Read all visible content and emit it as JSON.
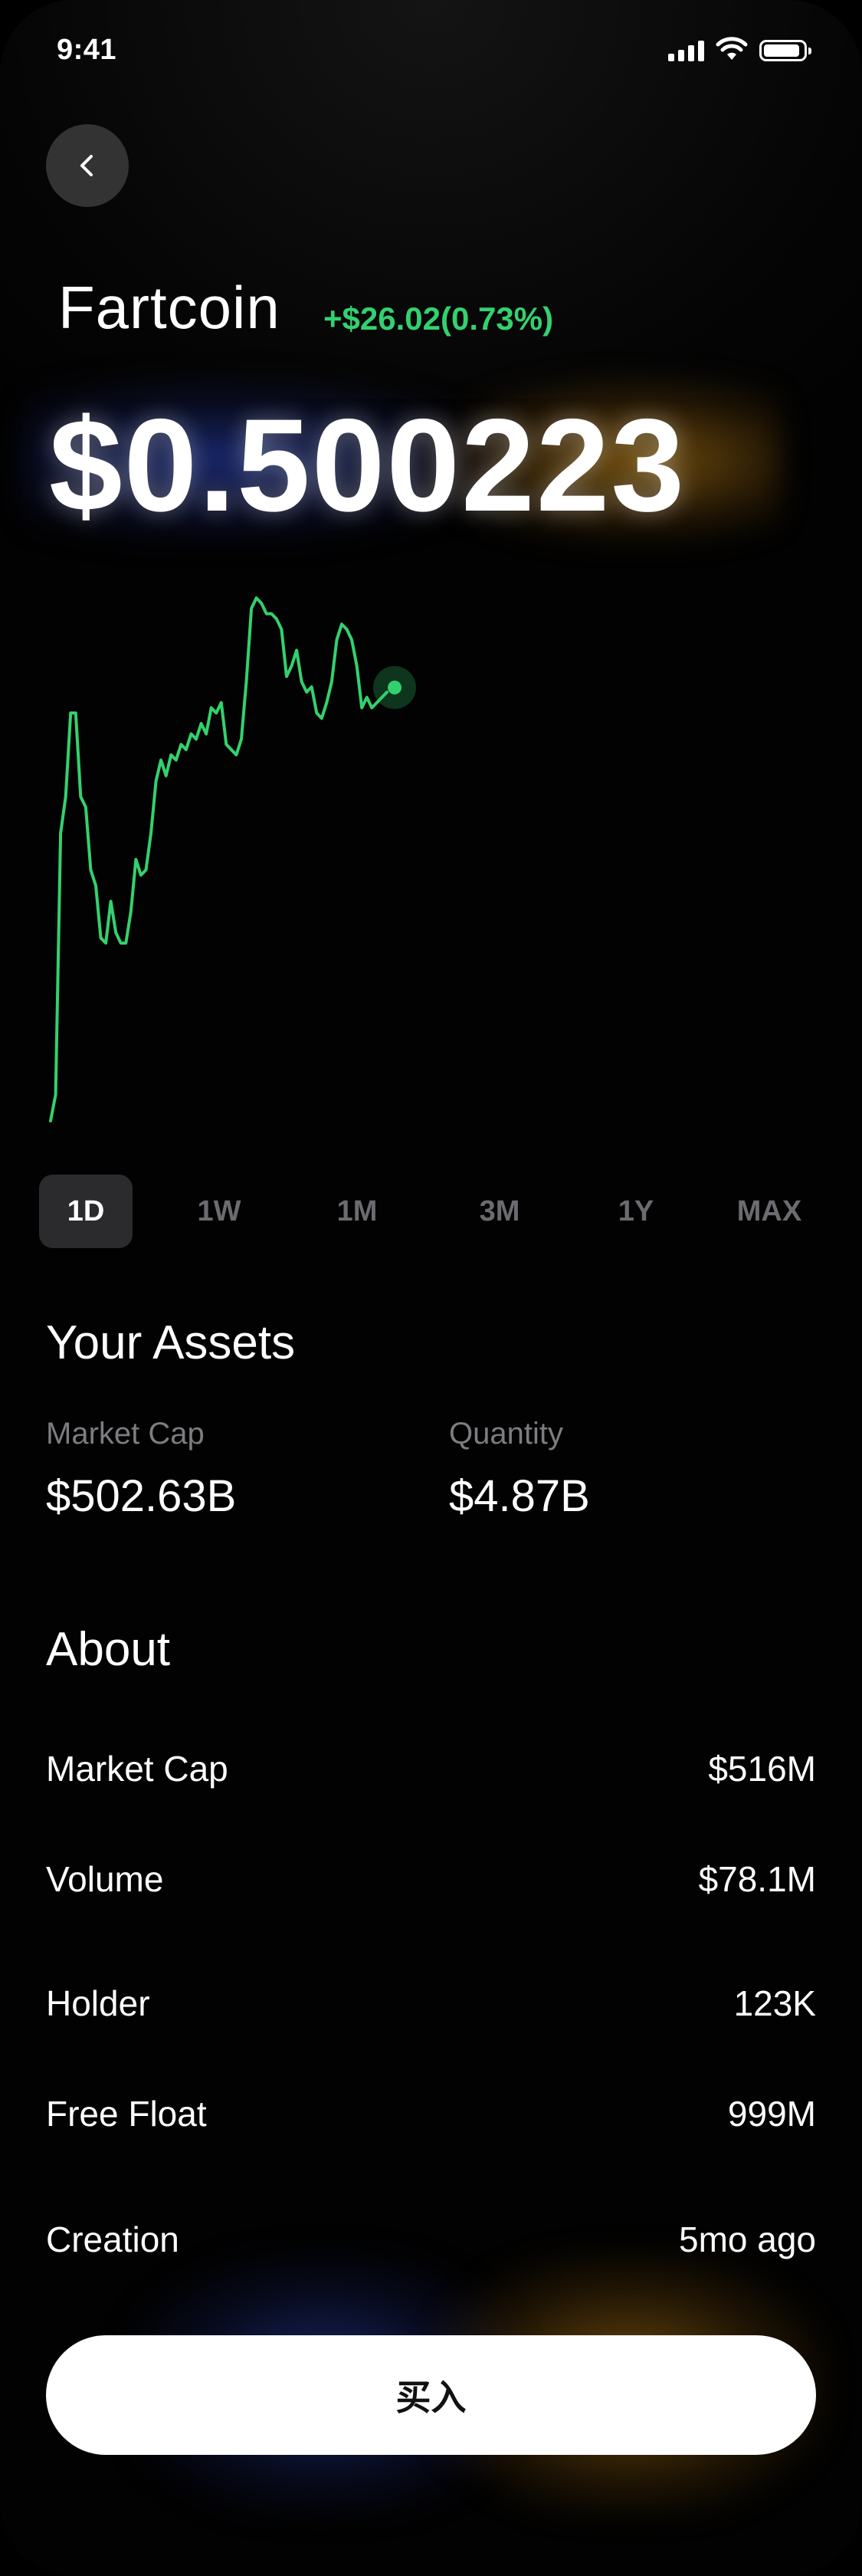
{
  "status_bar": {
    "time": "9:41"
  },
  "header": {
    "back_icon": "chevron-left-icon"
  },
  "coin": {
    "name": "Fartcoin",
    "change": "+$26.02(0.73%)",
    "price": "$0.500223"
  },
  "colors": {
    "accent_green": "#33d16e",
    "glow_blue": "#243896",
    "glow_gold": "#a06e14",
    "background": "#020202"
  },
  "chart_data": {
    "type": "line",
    "x": [
      0,
      1,
      2,
      3,
      4,
      5,
      6,
      7,
      8,
      9,
      10,
      11,
      12,
      13,
      14,
      15,
      16,
      17,
      18,
      19,
      20,
      21,
      22,
      23,
      24,
      25,
      26,
      27,
      28,
      29,
      30,
      31,
      32,
      33,
      34,
      35,
      36,
      37,
      38,
      39,
      40,
      41,
      42,
      43,
      44,
      45,
      46,
      47,
      48,
      49,
      50,
      51,
      52,
      53,
      54,
      55,
      56,
      57,
      58,
      59,
      60,
      61,
      62,
      63,
      64,
      65,
      66,
      67,
      68,
      69,
      70,
      71,
      72,
      73,
      74
    ],
    "values": [
      0.0,
      0.05,
      0.55,
      0.62,
      0.78,
      0.78,
      0.62,
      0.6,
      0.48,
      0.45,
      0.35,
      0.34,
      0.42,
      0.36,
      0.34,
      0.34,
      0.4,
      0.5,
      0.47,
      0.48,
      0.55,
      0.65,
      0.69,
      0.66,
      0.7,
      0.69,
      0.72,
      0.71,
      0.74,
      0.73,
      0.76,
      0.74,
      0.79,
      0.78,
      0.8,
      0.72,
      0.71,
      0.7,
      0.73,
      0.84,
      0.98,
      1.0,
      0.99,
      0.97,
      0.97,
      0.96,
      0.94,
      0.85,
      0.87,
      0.9,
      0.84,
      0.82,
      0.83,
      0.78,
      0.77,
      0.8,
      0.84,
      0.92,
      0.95,
      0.94,
      0.92,
      0.87,
      0.79,
      0.81,
      0.79,
      0.8,
      0.81,
      0.82
    ],
    "current_marker": true,
    "grid": false,
    "xlabel": "",
    "ylabel": ""
  },
  "ranges": [
    "1D",
    "1W",
    "1M",
    "3M",
    "1Y",
    "MAX"
  ],
  "active_range": "1D",
  "assets": {
    "title": "Your Assets",
    "market_cap_label": "Market Cap",
    "market_cap_value": "$502.63B",
    "quantity_label": "Quantity",
    "quantity_value": "$4.87B"
  },
  "about": {
    "title": "About",
    "rows": [
      {
        "label": "Market Cap",
        "value": "$516M"
      },
      {
        "label": "Volume",
        "value": "$78.1M"
      },
      {
        "label": "Holder",
        "value": "123K"
      },
      {
        "label": "Free Float",
        "value": "999M"
      },
      {
        "label": "Creation",
        "value": "5mo ago"
      }
    ]
  },
  "buy_button": {
    "label": "买入"
  }
}
